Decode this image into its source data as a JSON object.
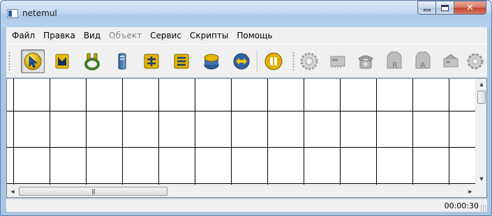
{
  "window": {
    "title": "netemul",
    "controls": [
      "minimize",
      "maximize",
      "close"
    ]
  },
  "menubar": {
    "items": [
      {
        "label": "Файл",
        "enabled": true
      },
      {
        "label": "Правка",
        "enabled": true
      },
      {
        "label": "Вид",
        "enabled": true
      },
      {
        "label": "Объект",
        "enabled": false
      },
      {
        "label": "Сервис",
        "enabled": true
      },
      {
        "label": "Скрипты",
        "enabled": true
      },
      {
        "label": "Помощь",
        "enabled": true
      }
    ]
  },
  "toolbar": {
    "tools": [
      {
        "icon": "select-arrow-icon",
        "pressed": true
      },
      {
        "icon": "note-icon"
      },
      {
        "icon": "cable-icon"
      },
      {
        "icon": "computer-icon"
      },
      {
        "icon": "hub-icon"
      },
      {
        "icon": "switch-icon"
      },
      {
        "icon": "router-icon"
      },
      {
        "icon": "link-icon"
      },
      {
        "icon": "pause-icon"
      }
    ],
    "disabled_tools": [
      {
        "icon": "settings-gear-icon"
      },
      {
        "icon": "network-card-icon"
      },
      {
        "icon": "telephone-icon"
      },
      {
        "icon": "rip-router-icon"
      },
      {
        "icon": "arp-table-icon"
      },
      {
        "icon": "device-properties-icon"
      },
      {
        "icon": "cog-icon"
      }
    ]
  },
  "statusbar": {
    "time": "00:00:30"
  },
  "colors": {
    "chrome_bg": "#f0f0f0",
    "titlebar": "#b8d2ee",
    "close_button": "#c2462c",
    "grid_lines": "#000000"
  }
}
